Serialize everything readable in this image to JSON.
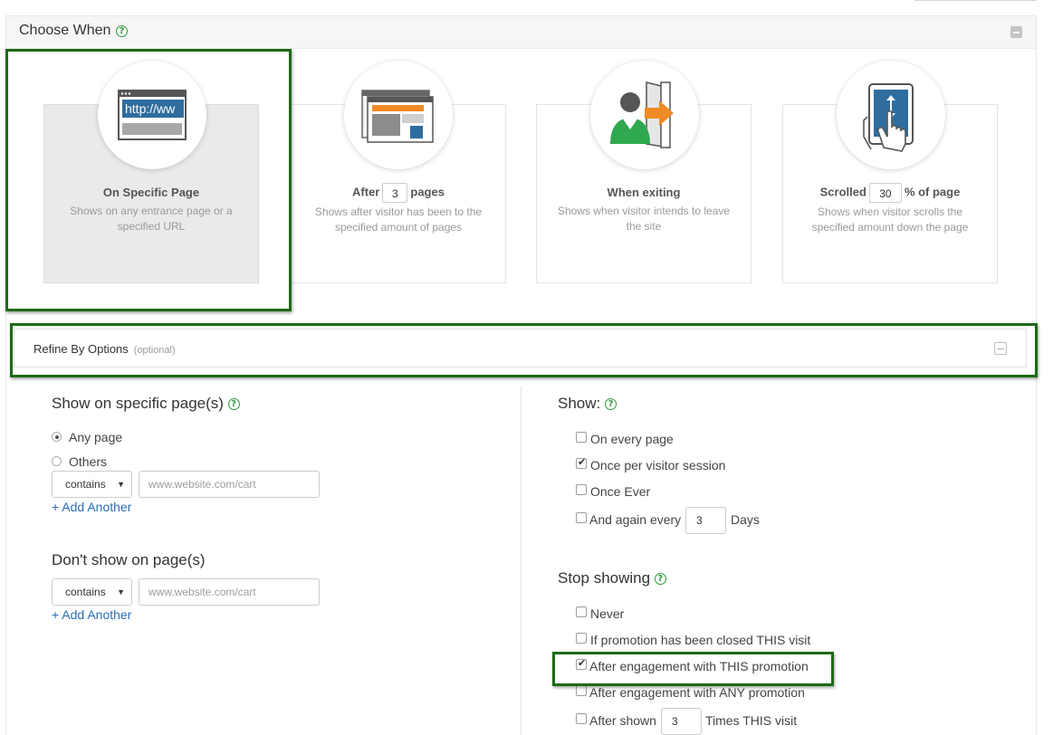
{
  "choose_when": {
    "title": "Choose When",
    "help_glyph": "?",
    "cards": [
      {
        "id": "on-specific-page",
        "icon": "browser-url-icon",
        "url_text": "http://ww",
        "title": "On Specific Page",
        "description": "Shows on any entrance page or a specified URL",
        "selected": true
      },
      {
        "id": "after-pages",
        "icon": "browser-windows-icon",
        "title_before": "After",
        "value": "3",
        "title_after": "pages",
        "description": "Shows after visitor has been to the specified amount of pages",
        "selected": false
      },
      {
        "id": "when-exiting",
        "icon": "person-exit-door-icon",
        "title": "When exiting",
        "description": "Shows when visitor intends to leave the site",
        "selected": false
      },
      {
        "id": "scrolled",
        "icon": "tablet-scroll-hand-icon",
        "title_before": "Scrolled",
        "value": "30",
        "title_after": "% of page",
        "description": "Shows when visitor scrolls the specified amount down the page",
        "selected": false
      }
    ]
  },
  "refine": {
    "title": "Refine By Options",
    "optional_label": "(optional)"
  },
  "show_on_pages": {
    "title": "Show on specific page(s)",
    "radio_any": "Any page",
    "radio_others": "Others",
    "selected": "any",
    "match_select": "contains",
    "url_placeholder": "www.website.com/cart",
    "add_another": "+ Add Another"
  },
  "dont_show_on_pages": {
    "title": "Don't show on page(s)",
    "match_select": "contains",
    "url_placeholder": "www.website.com/cart",
    "add_another": "+ Add Another"
  },
  "show": {
    "title": "Show:",
    "options": [
      {
        "label": "On every page",
        "checked": false
      },
      {
        "label": "Once per visitor session",
        "checked": true
      },
      {
        "label": "Once Ever",
        "checked": false
      }
    ],
    "again_every_label": "And again every",
    "again_every_value": "3",
    "again_every_unit": "Days",
    "again_every_checked": false
  },
  "stop_showing": {
    "title": "Stop showing",
    "options": [
      {
        "label": "Never",
        "checked": false
      },
      {
        "label": "If promotion has been closed THIS visit",
        "checked": false
      },
      {
        "label": "After engagement with THIS promotion",
        "checked": true
      },
      {
        "label": "After engagement with ANY promotion",
        "checked": false
      }
    ],
    "after_shown_label": "After shown",
    "after_shown_value": "3",
    "after_shown_unit": "Times THIS visit",
    "after_shown_checked": false
  },
  "colors": {
    "highlight_green": "#1d6a15",
    "help_green": "#2e9b3a",
    "link_blue": "#2a6db4",
    "icon_blue": "#2f6d9f",
    "icon_orange": "#ef8a24",
    "icon_green": "#2fa84f"
  }
}
